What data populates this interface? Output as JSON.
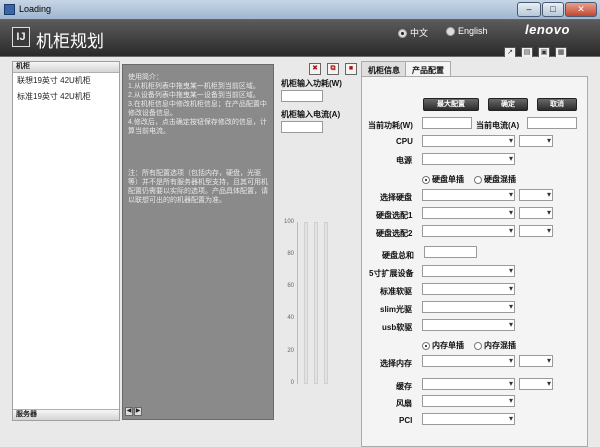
{
  "window": {
    "title": "Loading",
    "minimize": "–",
    "maximize": "□",
    "close": "✕"
  },
  "header": {
    "logo_glyph": "IJ",
    "title": "机柜规划",
    "lang_zh": "中文",
    "lang_en": "English",
    "brand": "lenovo"
  },
  "sidebar": {
    "header": "机柜",
    "items": [
      {
        "label": "联想19英寸 42U机柜"
      },
      {
        "label": "标准19英寸 42U机柜"
      }
    ],
    "footer": "服务器"
  },
  "info": {
    "intro": "使用简介：\n1.从机柜列表中拖曳某一机柜到当前区域。\n2.从设备列表中拖曳某一设备到当前区域。\n3.在机柜信息中修改机柜信息；在产品配置中修改设备信息。\n4.修改后，点击确定按钮保存修改的信息，计算当前电流。",
    "note": "注：所有配置选项（包括内存，硬盘，光驱等）并不是所有服务器机型支持，且其可用机配置仍需要以实际的选项。产品具体配置，请以联想可出的的机器配置为准。"
  },
  "power": {
    "power_label": "机柜输入功耗(W)",
    "current_label": "机柜输入电流(A)",
    "chart_ticks": [
      "100",
      "80",
      "60",
      "40",
      "20",
      "0"
    ]
  },
  "tabs": [
    {
      "label": "机柜信息"
    },
    {
      "label": "产品配置"
    }
  ],
  "buttons": {
    "max_config": "最大配置",
    "ok": "确定",
    "cancel": "取消"
  },
  "config": {
    "current_power": "当前功耗(W)",
    "current_amp": "当前电流(A)",
    "cpu": "CPU",
    "psu": "电源",
    "hdd_single": "硬盘单插",
    "hdd_mixed": "硬盘混插",
    "select_hdd": "选择硬盘",
    "hdd_option1": "硬盘选配1",
    "hdd_option2": "硬盘选配2",
    "hdd_total": "硬盘总和",
    "bay525": "5寸扩展设备",
    "std_odd": "标准软驱",
    "slim_odd": "slim光驱",
    "usb_odd": "usb软驱",
    "mem_single": "内存单插",
    "mem_mixed": "内存混插",
    "select_mem": "选择内存",
    "cache": "缓存",
    "fan": "风扇",
    "pci": "PCI"
  }
}
